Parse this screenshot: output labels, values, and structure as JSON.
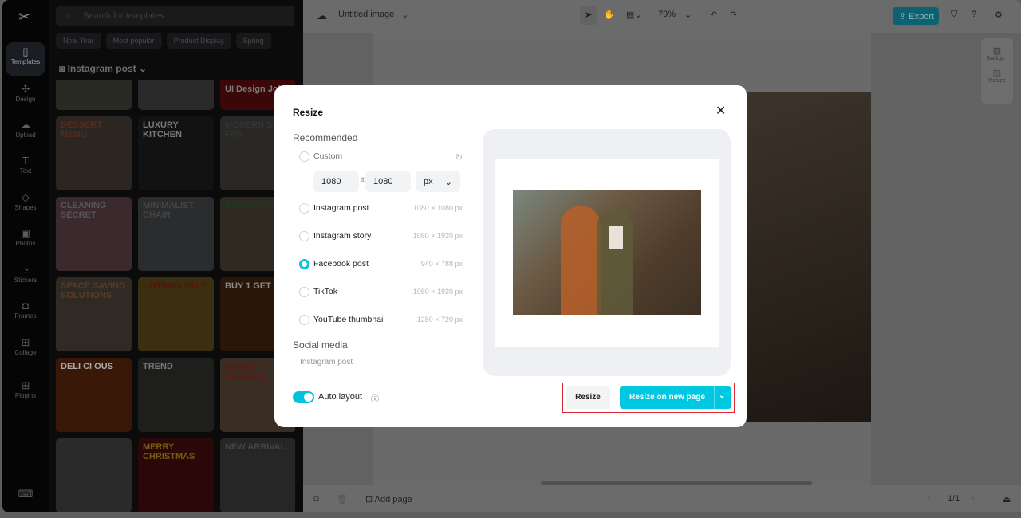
{
  "sidebar": {
    "items": [
      {
        "label": "Templates",
        "icon": "templates-icon"
      },
      {
        "label": "Design",
        "icon": "design-icon"
      },
      {
        "label": "Upload",
        "icon": "upload-icon"
      },
      {
        "label": "Text",
        "icon": "text-icon"
      },
      {
        "label": "Shapes",
        "icon": "shapes-icon"
      },
      {
        "label": "Photos",
        "icon": "photos-icon"
      },
      {
        "label": "Stickers",
        "icon": "stickers-icon"
      },
      {
        "label": "Frames",
        "icon": "frames-icon"
      },
      {
        "label": "Collage",
        "icon": "collage-icon"
      },
      {
        "label": "Plugins",
        "icon": "plugins-icon"
      }
    ]
  },
  "templates": {
    "search_placeholder": "Search for templates",
    "chips": [
      "New Year",
      "Most popular",
      "Product Display",
      "Spring"
    ],
    "category": "Instagram post",
    "thumbs": [
      "",
      "",
      "UI Design Job",
      "DESSERT MENU",
      "LUXURY KITCHEN",
      "MODERN SOFA FOR",
      "CLEANING SECRET",
      "MINIMALIST CHAIR",
      "BAKE WITH CA",
      "SPACE SAVING SOLUTIONS",
      "HOTDOG SALE",
      "BUY 1 GET",
      "DELI CI OUS",
      "TREND",
      "Special Cupcakes",
      "",
      "MERRY CHRISTMAS",
      "NEW ARRIVAL"
    ]
  },
  "topbar": {
    "title": "Untitled image",
    "zoom": "79%",
    "export": "Export"
  },
  "right_panel": {
    "background": "Backgr...",
    "resize": "Resize"
  },
  "bottombar": {
    "add_page": "Add page",
    "page_indicator": "1/1"
  },
  "modal": {
    "title": "Resize",
    "recommended": "Recommended",
    "custom": "Custom",
    "width": "1080",
    "height": "1080",
    "unit": "px",
    "options": [
      {
        "label": "Instagram post",
        "size": "1080 × 1080 px",
        "selected": false
      },
      {
        "label": "Instagram story",
        "size": "1080 × 1920 px",
        "selected": false
      },
      {
        "label": "Facebook post",
        "size": "940 × 788 px",
        "selected": true
      },
      {
        "label": "TikTok",
        "size": "1080 × 1920 px",
        "selected": false
      },
      {
        "label": "YouTube thumbnail",
        "size": "1280 × 720 px",
        "selected": false
      }
    ],
    "social_media": "Social media",
    "social_item": "Instagram post",
    "auto_layout": "Auto layout",
    "resize_btn": "Resize",
    "resize_new_btn": "Resize on new page"
  },
  "colors": {
    "accent": "#00c8e0",
    "highlight": "#e0262e"
  }
}
